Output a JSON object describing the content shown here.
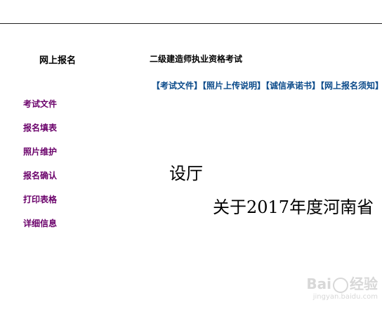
{
  "sidebar": {
    "title": "网上报名",
    "items": [
      {
        "label": "考试文件"
      },
      {
        "label": "报名填表"
      },
      {
        "label": "照片维护"
      },
      {
        "label": "报名确认"
      },
      {
        "label": "打印表格"
      },
      {
        "label": "详细信息"
      }
    ]
  },
  "header": {
    "exam_title": "二级建造师执业资格考试"
  },
  "links": [
    {
      "label": "【考试文件】"
    },
    {
      "label": "【照片上传说明】"
    },
    {
      "label": "【诚信承诺书】"
    },
    {
      "label": "【网上报名须知】"
    }
  ],
  "content": {
    "heading1": "设厅",
    "heading2": "关于2017年度河南省"
  },
  "watermark": {
    "brand_left": "Bai",
    "brand_right": "经验",
    "url": "jingyan.baidu.com"
  }
}
